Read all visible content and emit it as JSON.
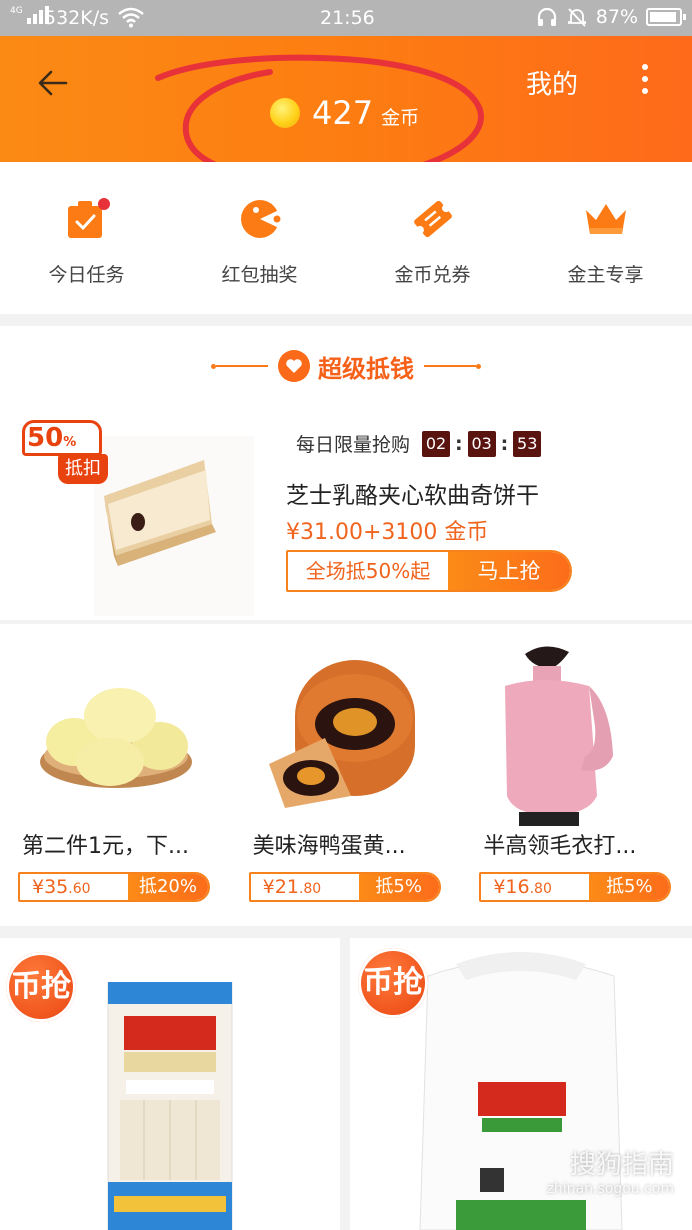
{
  "status_bar": {
    "network_type": "4G",
    "speed": "532K/s",
    "time": "21:56",
    "battery": "87%"
  },
  "header": {
    "coins": "427",
    "coin_unit": "金币",
    "mine": "我的"
  },
  "quick_menu": [
    {
      "label": "今日任务",
      "icon": "task-bag-icon"
    },
    {
      "label": "红包抽奖",
      "icon": "lottery-icon"
    },
    {
      "label": "金币兑券",
      "icon": "coupon-ticket-icon"
    },
    {
      "label": "金主专享",
      "icon": "crown-icon"
    }
  ],
  "super_section": {
    "title": "超级抵钱",
    "badge_percent": "50",
    "badge_pct_sign": "%",
    "badge_label": "抵扣",
    "daily_label": "每日限量抢购",
    "countdown": [
      "02",
      "03",
      "53"
    ],
    "product_title": "芝士乳酪夹心软曲奇饼干",
    "product_price": "¥31.00+3100 金币",
    "discount_btn": "全场抵50%起",
    "buy_btn": "马上抢"
  },
  "products": [
    {
      "name": "第二件1元，下...",
      "price_int": "¥35",
      "price_dec": ".60",
      "discount": "抵20%"
    },
    {
      "name": "美味海鸭蛋黄...",
      "price_int": "¥21",
      "price_dec": ".80",
      "discount": "抵5%"
    },
    {
      "name": "半高领毛衣打...",
      "price_int": "¥16",
      "price_dec": ".80",
      "discount": "抵5%"
    }
  ],
  "bottom_cards": [
    {
      "stamp": "币抢"
    },
    {
      "stamp": "币抢"
    }
  ],
  "watermark": {
    "text": "搜狗指南",
    "url": "zhinan.sogou.com"
  },
  "colors": {
    "brand_orange": "#fc7b14",
    "accent_red": "#e8420f",
    "annotation_red": "#e8323a"
  }
}
